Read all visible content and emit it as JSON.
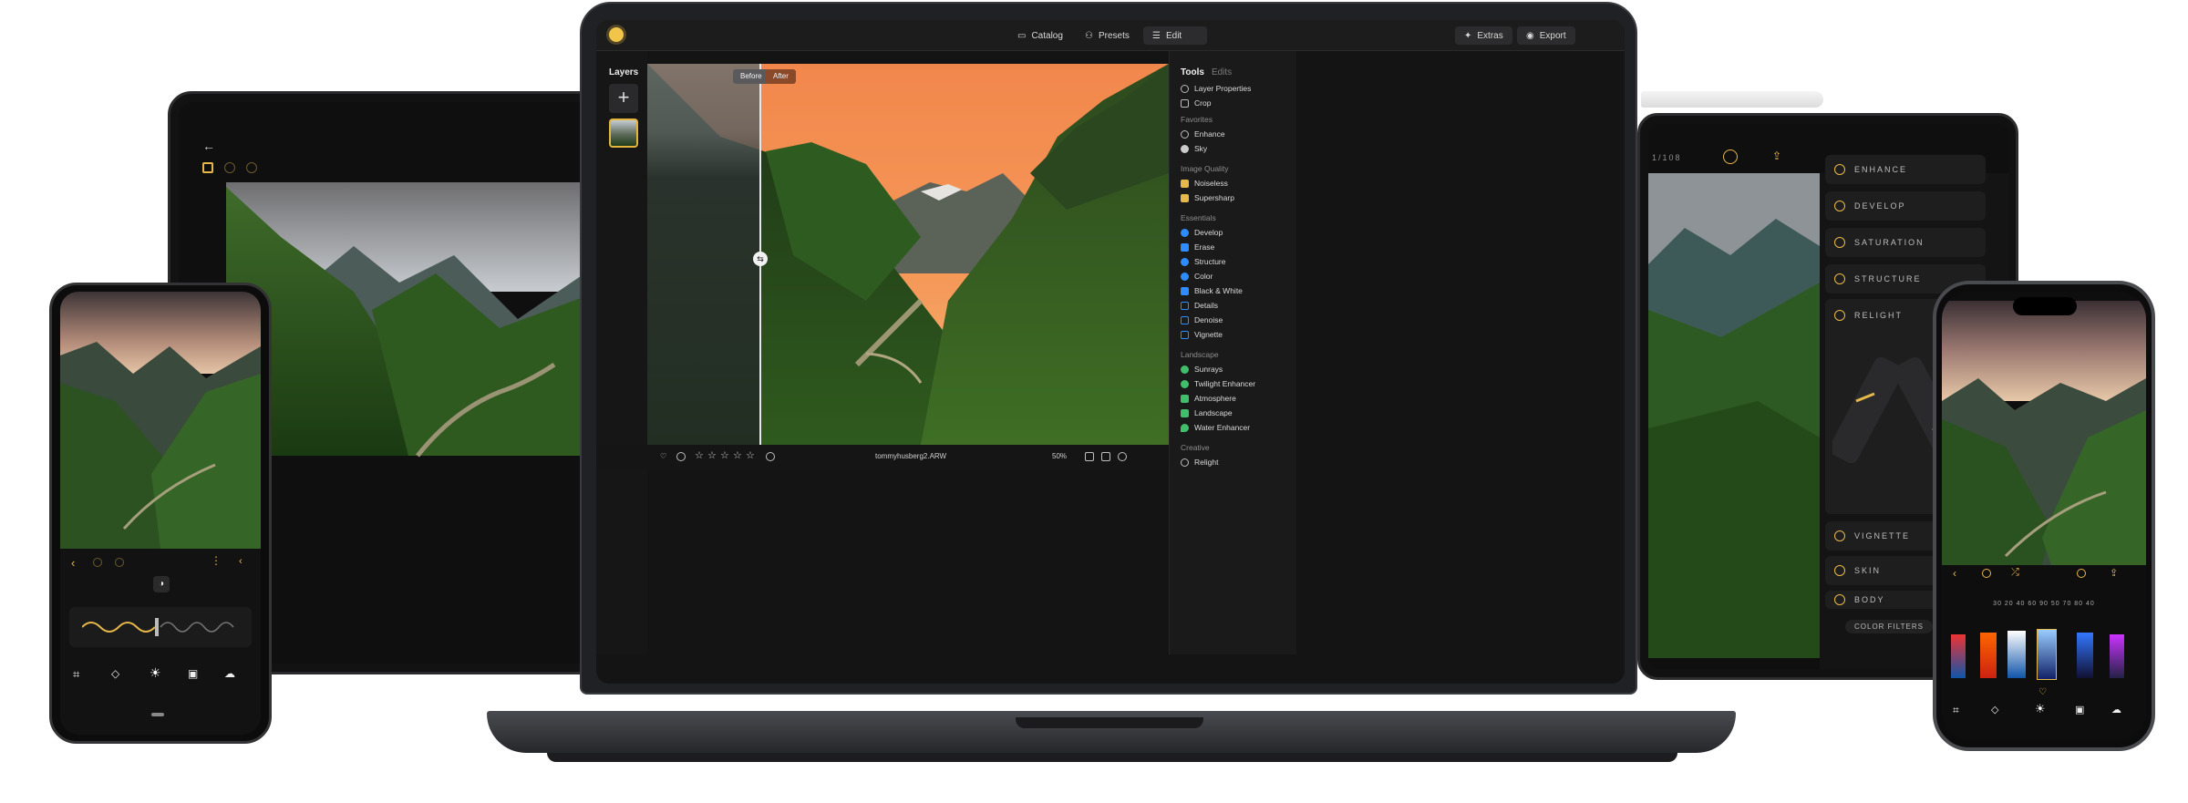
{
  "laptop": {
    "top_tabs": {
      "catalog": "Catalog",
      "presets": "Presets",
      "edit": "Edit"
    },
    "top_actions": {
      "extras": "Extras",
      "export": "Export"
    },
    "layers_title": "Layers",
    "compare": {
      "before": "Before",
      "after": "After"
    },
    "filename": "tommyhusberg2.ARW",
    "zoom": "50%",
    "right_panel": {
      "tab_tools": "Tools",
      "tab_edits": "Edits",
      "items_top": [
        "Layer Properties",
        "Crop"
      ],
      "sections": [
        {
          "title": "Favorites",
          "items": [
            "Enhance",
            "Sky"
          ]
        },
        {
          "title": "Image Quality",
          "items": [
            "Noiseless",
            "Supersharp"
          ]
        },
        {
          "title": "Essentials",
          "items": [
            "Develop",
            "Erase",
            "Structure",
            "Color",
            "Black & White",
            "Details",
            "Denoise",
            "Vignette"
          ]
        },
        {
          "title": "Landscape",
          "items": [
            "Sunrays",
            "Twilight Enhancer",
            "Atmosphere",
            "Landscape",
            "Water Enhancer"
          ]
        },
        {
          "title": "Creative",
          "items": [
            "Relight"
          ]
        }
      ]
    }
  },
  "ipad": {
    "counter": "1/108",
    "tools": [
      "ENHANCE",
      "DEVELOP",
      "SATURATION",
      "STRUCTURE",
      "RELIGHT",
      "VIGNETTE",
      "SKIN",
      "BODY"
    ],
    "color_filters": "COLOR FILTERS"
  },
  "iphone": {
    "ruler": "30 20 40 60 90 50 70 80 40"
  },
  "colors": {
    "accent": "#e6b84a",
    "panel_bg": "#1a1a1b",
    "sky_orange": "#f2894e"
  }
}
